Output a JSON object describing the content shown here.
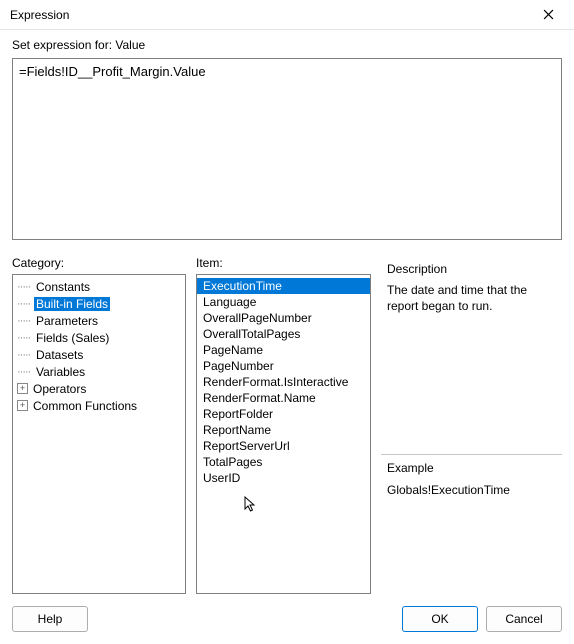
{
  "window": {
    "title": "Expression"
  },
  "setExpressionLabel": "Set expression for: Value",
  "expressionValue": "=Fields!ID__Profit_Margin.Value",
  "labels": {
    "category": "Category:",
    "item": "Item:",
    "description": "Description",
    "example": "Example"
  },
  "categoryTree": [
    {
      "label": "Constants",
      "expandable": false,
      "selected": false
    },
    {
      "label": "Built-in Fields",
      "expandable": false,
      "selected": true
    },
    {
      "label": "Parameters",
      "expandable": false,
      "selected": false
    },
    {
      "label": "Fields (Sales)",
      "expandable": false,
      "selected": false
    },
    {
      "label": "Datasets",
      "expandable": false,
      "selected": false
    },
    {
      "label": "Variables",
      "expandable": false,
      "selected": false
    },
    {
      "label": "Operators",
      "expandable": true,
      "selected": false
    },
    {
      "label": "Common Functions",
      "expandable": true,
      "selected": false
    }
  ],
  "items": [
    {
      "label": "ExecutionTime",
      "selected": true
    },
    {
      "label": "Language",
      "selected": false
    },
    {
      "label": "OverallPageNumber",
      "selected": false
    },
    {
      "label": "OverallTotalPages",
      "selected": false
    },
    {
      "label": "PageName",
      "selected": false
    },
    {
      "label": "PageNumber",
      "selected": false
    },
    {
      "label": "RenderFormat.IsInteractive",
      "selected": false
    },
    {
      "label": "RenderFormat.Name",
      "selected": false
    },
    {
      "label": "ReportFolder",
      "selected": false
    },
    {
      "label": "ReportName",
      "selected": false
    },
    {
      "label": "ReportServerUrl",
      "selected": false
    },
    {
      "label": "TotalPages",
      "selected": false
    },
    {
      "label": "UserID",
      "selected": false
    }
  ],
  "descriptionText": "The date and time that the report began to run.",
  "exampleText": "Globals!ExecutionTime",
  "buttons": {
    "help": "Help",
    "ok": "OK",
    "cancel": "Cancel"
  }
}
